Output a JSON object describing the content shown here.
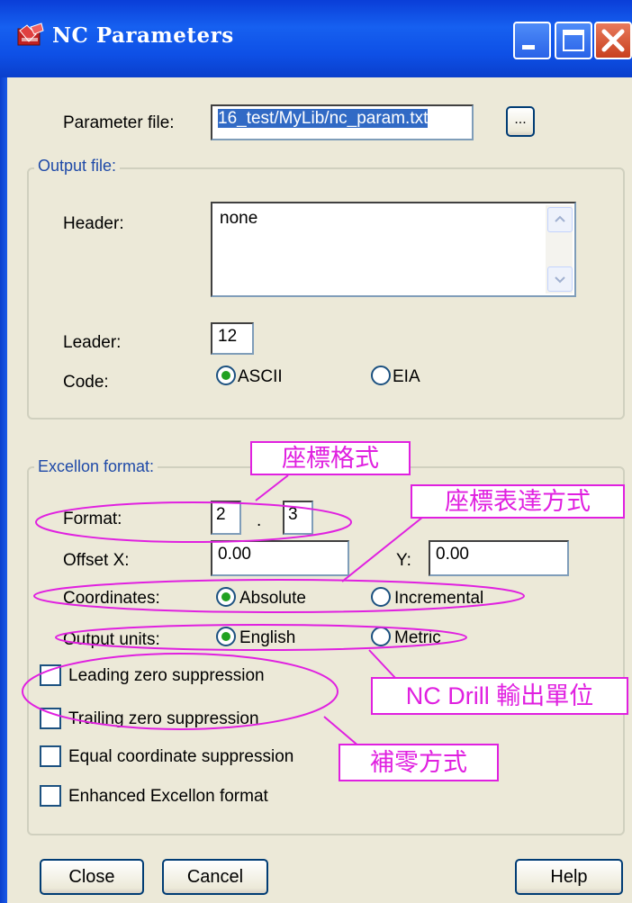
{
  "window": {
    "title": "NC Parameters"
  },
  "parameter_file": {
    "label": "Parameter file:",
    "value": "16_test/MyLib/nc_param.txt",
    "browse_label": "..."
  },
  "output_file": {
    "group_label": "Output file:",
    "header_label": "Header:",
    "header_value": "none",
    "leader_label": "Leader:",
    "leader_value": "12",
    "code_label": "Code:",
    "code_options": [
      {
        "label": "ASCII",
        "selected": true
      },
      {
        "label": "EIA",
        "selected": false
      }
    ]
  },
  "excellon": {
    "group_label": "Excellon format:",
    "format_label": "Format:",
    "format_int": "2",
    "format_sep": ".",
    "format_dec": "3",
    "offset_x_label": "Offset X:",
    "offset_x_value": "0.00",
    "offset_y_label": "Y:",
    "offset_y_value": "0.00",
    "coordinates_label": "Coordinates:",
    "coordinates_options": [
      {
        "label": "Absolute",
        "selected": true
      },
      {
        "label": "Incremental",
        "selected": false
      }
    ],
    "output_units_label": "Output units:",
    "output_units_options": [
      {
        "label": "English",
        "selected": true
      },
      {
        "label": "Metric",
        "selected": false
      }
    ],
    "checkboxes": [
      {
        "label": "Leading zero suppression",
        "checked": false
      },
      {
        "label": "Trailing zero suppression",
        "checked": false
      },
      {
        "label": "Equal coordinate suppression",
        "checked": false
      },
      {
        "label": "Enhanced Excellon format",
        "checked": false
      }
    ]
  },
  "buttons": {
    "close": "Close",
    "cancel": "Cancel",
    "help": "Help"
  },
  "annotations": {
    "format": "座標格式",
    "coordinates": "座標表達方式",
    "output_units": "NC Drill 輸出單位",
    "zero_suppression": "補零方式"
  },
  "colors": {
    "annotation": "#e020e0",
    "group_label": "#1f4aa8",
    "title_bar": "#0a3ed8",
    "radio_selected": "#21a121"
  }
}
